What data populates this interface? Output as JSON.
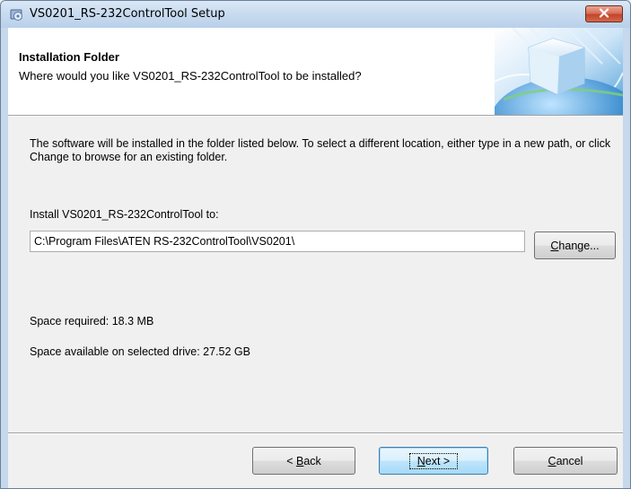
{
  "window": {
    "title": "VS0201_RS-232ControlTool Setup"
  },
  "banner": {
    "title": "Installation Folder",
    "subtitle": "Where would you like VS0201_RS-232ControlTool to be installed?"
  },
  "content": {
    "description": "The software will be installed in the folder listed below. To select a different location, either type in a new path, or click Change to browse for an existing folder.",
    "install_label": "Install VS0201_RS-232ControlTool to:",
    "install_path": "C:\\Program Files\\ATEN RS-232ControlTool\\VS0201\\",
    "change_button": {
      "mnemonic": "C",
      "rest": "hange..."
    },
    "space_required": "Space required: 18.3 MB",
    "space_available": "Space available on selected drive: 27.52 GB"
  },
  "footer": {
    "back_button": {
      "prefix": "< ",
      "mnemonic": "B",
      "rest": "ack"
    },
    "next_button": {
      "mnemonic": "N",
      "rest": "ext >"
    },
    "cancel_button": {
      "mnemonic": "C",
      "rest": "ancel"
    }
  },
  "icons": {
    "title": "installer-icon",
    "close": "close-icon",
    "banner": "globe-cube-icon"
  },
  "colors": {
    "titlebar": "#c9dcf0",
    "close_button": "#c2442a",
    "default_button_border": "#3c7fb1",
    "dialog_background": "#f0f0f0"
  }
}
